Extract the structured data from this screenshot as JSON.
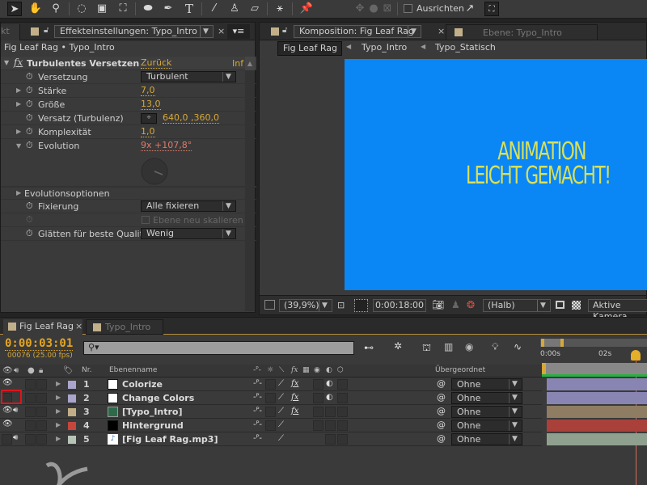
{
  "toolbar": {
    "tools": [
      "selection-tool",
      "hand-tool",
      "zoom-tool",
      "rotate-tool",
      "camera-tool",
      "pan-behind-tool",
      "ellipse-tool",
      "pen-tool",
      "text-tool",
      "brush-tool",
      "clone-stamp-tool",
      "eraser-tool",
      "roto-brush-tool",
      "puppet-pin-tool"
    ],
    "align_label": "Ausrichten"
  },
  "effects_panel": {
    "left_tab_fragment": "kt",
    "tab_title": "Effekteinstellungen: Typo_Intro",
    "breadcrumb": "Fig Leaf Rag • Typo_Intro",
    "effect": {
      "name": "Turbulentes Versetzen",
      "reset_label": "Zurück",
      "about_label": "Inf"
    },
    "properties": [
      {
        "label": "Versetzung",
        "type": "dropdown",
        "value": "Turbulent"
      },
      {
        "label": "Stärke",
        "type": "value",
        "value": "7,0"
      },
      {
        "label": "Größe",
        "type": "value",
        "value": "13,0"
      },
      {
        "label": "Versatz (Turbulenz)",
        "type": "point",
        "value": "640,0 ,360,0"
      },
      {
        "label": "Komplexität",
        "type": "value",
        "value": "1,0"
      },
      {
        "label": "Evolution",
        "type": "angle",
        "value": "9x +107,8°"
      }
    ],
    "evolution_options_label": "Evolutionsoptionen",
    "fixierung": {
      "label": "Fixierung",
      "value": "Alle fixieren"
    },
    "rescale_label": "Ebene neu skalieren",
    "smoothing": {
      "label": "Glätten für beste Qualit",
      "value": "Wenig"
    }
  },
  "comp_panel": {
    "tab_title": "Komposition: Fig Leaf Rag",
    "layer_tab": "Ebene: Typo_Intro",
    "flow": [
      "Fig Leaf Rag",
      "Typo_Intro",
      "Typo_Statisch"
    ],
    "canvas_text": [
      "ANIMATION",
      "LEICHT GEMACHT!"
    ],
    "canvas_bg": "#0a86f5",
    "canvas_text_color": "#d8e05a",
    "zoom": "(39,9%)",
    "timecode": "0:00:18:00",
    "resolution": "(Halb)",
    "camera": "Aktive Kamera"
  },
  "timeline": {
    "tabs": [
      "Fig Leaf Rag",
      "Typo_Intro"
    ],
    "current_time": "0:00:03:01",
    "frame_info": "00076 (25.00 fps)",
    "columns": {
      "nr": "Nr.",
      "name": "Ebenenname",
      "parent": "Übergeordnet"
    },
    "ruler": [
      "0:00s",
      "02s"
    ],
    "layers": [
      {
        "nr": "1",
        "name": "Colorize",
        "label_color": "#a9a5cc",
        "visible": true,
        "audio": false,
        "fx": true,
        "parent": "Ohne",
        "bar_color": "#8885b2"
      },
      {
        "nr": "2",
        "name": "Change Colors",
        "label_color": "#a9a5cc",
        "visible": false,
        "audio": false,
        "fx": true,
        "parent": "Ohne",
        "bar_color": "#8885b2"
      },
      {
        "nr": "3",
        "name": "[Typo_Intro]",
        "label_color": "#c2ad86",
        "visible": true,
        "audio": true,
        "fx": true,
        "parent": "Ohne",
        "bar_color": "#8e7d62"
      },
      {
        "nr": "4",
        "name": "Hintergrund",
        "label_color": "#c4463d",
        "visible": true,
        "audio": false,
        "fx": false,
        "parent": "Ohne",
        "bar_color": "#a9403a"
      },
      {
        "nr": "5",
        "name": "[Fig Leaf Rag.mp3]",
        "label_color": "#b5c4b6",
        "visible": false,
        "audio": true,
        "fx": false,
        "parent": "Ohne",
        "bar_color": "#8fa08f"
      }
    ]
  }
}
